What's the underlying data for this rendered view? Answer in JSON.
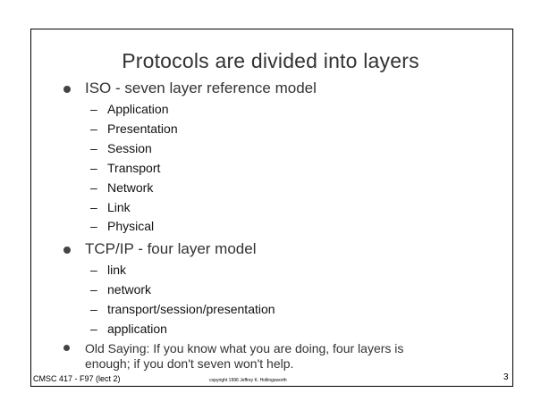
{
  "slide": {
    "title": "Protocols are divided into layers",
    "bullets": [
      {
        "text": "ISO - seven layer reference model",
        "items": [
          "Application",
          "Presentation",
          "Session",
          "Transport",
          "Network",
          "Link",
          "Physical"
        ]
      },
      {
        "text": "TCP/IP - four layer model",
        "items": [
          "link",
          "network",
          "transport/session/presentation",
          "application"
        ]
      },
      {
        "text_line1": "Old Saying: If you know what you are doing, four layers is",
        "text_line2": "enough; if you don't seven won't help."
      }
    ],
    "dash": "–"
  },
  "footer": {
    "course": "CMSC 417 - F97  (lect 2)",
    "copyright": "copyright 1996 Jeffrey K. Hollingsworth",
    "page_number": "3"
  }
}
